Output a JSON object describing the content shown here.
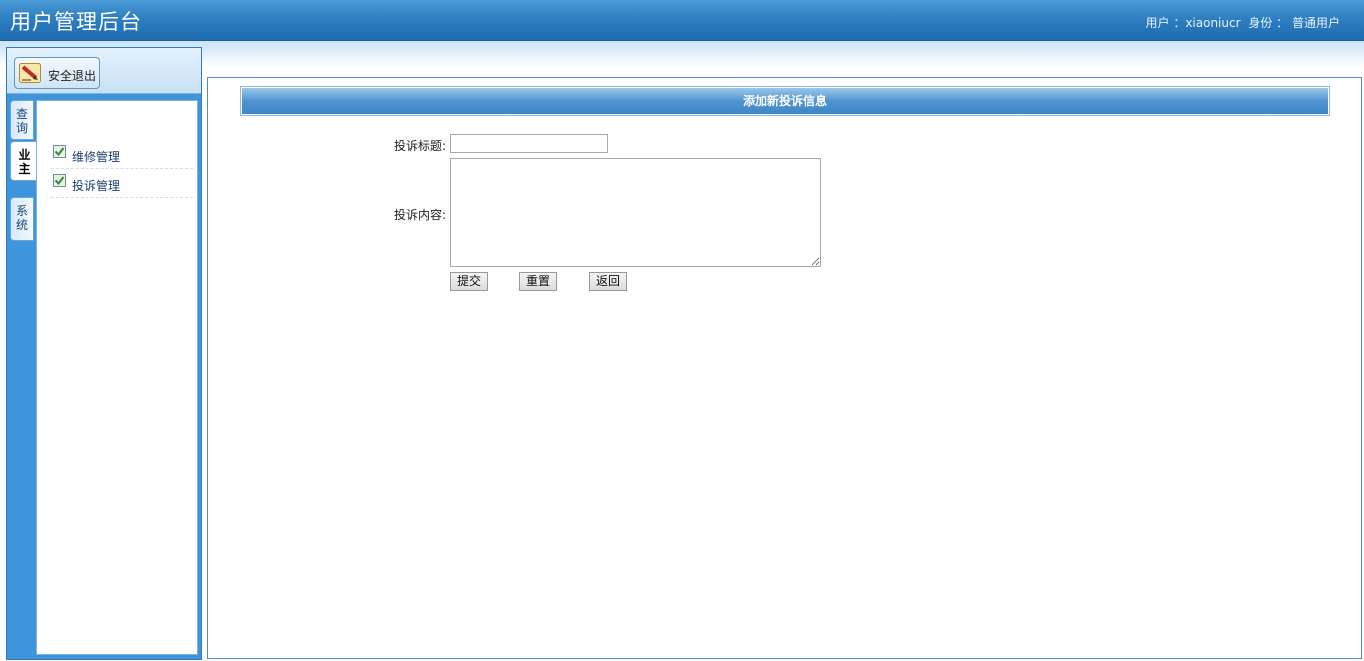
{
  "header": {
    "title": "用户管理后台",
    "user_label": "用户 ：xiaoniucr",
    "role_label": "身份 ： 普通用户"
  },
  "sidebar": {
    "logout_label": "安全退出",
    "tabs": [
      {
        "label_top": "查",
        "label_bottom": "询"
      },
      {
        "label_top": "业",
        "label_bottom": "主"
      },
      {
        "label_top": "系",
        "label_bottom": "统"
      }
    ],
    "active_tab": 1,
    "menu_items": [
      {
        "label": "维修管理"
      },
      {
        "label": "投诉管理"
      }
    ]
  },
  "form": {
    "header_title": "添加新投诉信息",
    "title_label": "投诉标题:",
    "title_value": "",
    "content_label": "投诉内容:",
    "content_value": "",
    "submit_label": "提交",
    "reset_label": "重置",
    "back_label": "返回"
  },
  "colors": {
    "header_blue": "#2f7fc2",
    "sidebar_blue": "#3f95dc",
    "form_header_blue": "#4f94d0",
    "menu_text": "#1a3e6e"
  },
  "icons": {
    "logout": "pen-icon",
    "menu_item": "checkbox-icon"
  }
}
